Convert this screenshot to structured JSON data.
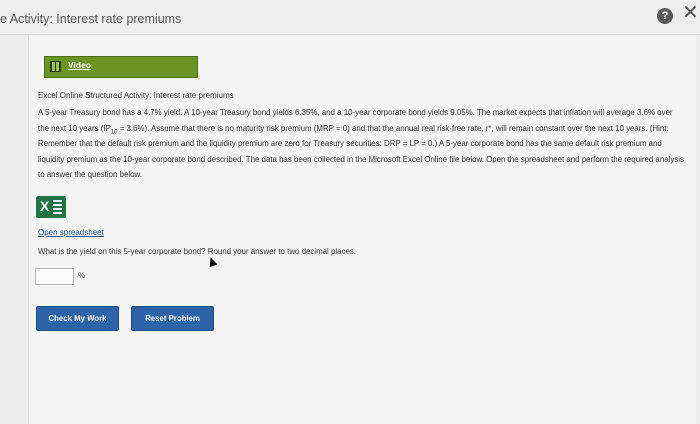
{
  "header": {
    "title": "e Activity: Interest rate premiums",
    "help_glyph": "?",
    "close_glyph": "✕"
  },
  "video": {
    "label": "Video"
  },
  "content": {
    "heading": "Excel Online Structured Activity: Interest rate premiums",
    "para_part1": "A 5-year Treasury bond has a 4.7% yield. A 10-year Treasury bond yields 6.35%, and a 10-year corporate bond yields 9.05%. The market expects that inflation will average 3.6% over the next 10 years (IP",
    "para_sub": "10",
    "para_part2": " = 3.6%). Assume that there is no maturity risk premium (MRP = 0) and that the annual real risk-free rate, r*, will remain constant over the next 10 years. (Hint: Remember that the default risk premium and the liquidity premium are zero for Treasury securities: DRP = LP = 0.) A 5-year corporate bond has the same default risk premium and liquidity premium as the 10-year corporate bond described. The data has been collected in the Microsoft Excel Online file below. Open the spreadsheet and perform the required analysis to answer the question below.",
    "excel_glyph": "X",
    "open_link": "Open spreadsheet",
    "question": "What is the yield on this 5-year corporate bond? Round your answer to two decimal places.",
    "answer_value": "",
    "unit": "%"
  },
  "buttons": {
    "check": "Check My Work",
    "reset": "Reset Problem"
  }
}
